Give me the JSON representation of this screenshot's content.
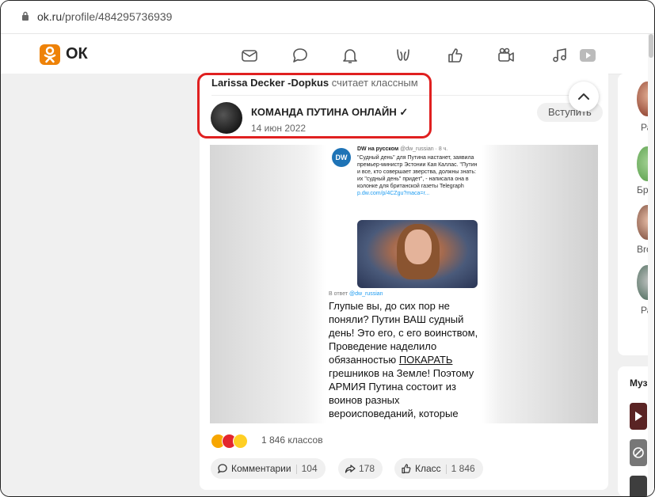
{
  "browser": {
    "url_domain": "ok.ru",
    "url_path": "/profile/484295736939"
  },
  "brand": {
    "logo_text": "ОК",
    "accent": "#ee8208"
  },
  "nav": {
    "icons": [
      "mail-icon",
      "chat-icon",
      "bell-icon",
      "guests-icon",
      "like-icon",
      "video-camera-icon",
      "music-icon",
      "video-play-icon"
    ]
  },
  "post": {
    "liked_by_name": "Larissa Decker -Dopkus",
    "liked_by_action": "считает классным",
    "group_name": "КОМАНДА ПУТИНА ОНЛАЙН ✓",
    "date": "14 июн 2022",
    "join_label": "Вступить",
    "image": {
      "dw_logo": "DW",
      "tweet_author": "DW на русском",
      "tweet_handle": "@dw_russian · 8 ч.",
      "tweet_text": "\"Судный день\" для Путина настанет, заявила премьер-министр Эстонии Кая Каллас. \"Путин и все, кто совершает зверства, должны знать: их \"судный день\" придет\", - написала она в колонке для британской газеты Telegraph",
      "tweet_link": "p.dw.com/p/4CZgu?maca=r...",
      "reply_label": "В ответ",
      "reply_handle": "@dw_russian",
      "reply_text_1": "Глупые вы, до сих пор не поняли? Путин ВАШ судный день! Это его, с его воинством, Проведение наделило обязанностью ",
      "reply_underlined": "ПОКАРАТЬ",
      "reply_text_2": " грешников на Земле! Поэтому АРМИЯ Путина состоит из воинов разных вероисповеданий, которые ЕДИНЫ В БОРЬБЕ со Злом!"
    },
    "reactions_count": "1 846 классов",
    "actions": {
      "comments_label": "Комментарии",
      "comments_count": "104",
      "shares_count": "178",
      "class_label": "Класс",
      "class_count": "1 846"
    }
  },
  "right_column": {
    "friends": [
      {
        "name": "Ра"
      },
      {
        "name": "Бро"
      },
      {
        "name": "Bro"
      },
      {
        "name": "Ра"
      }
    ],
    "music_title": "Музы"
  },
  "colors": {
    "highlight": "#e02020",
    "link": "#1d9bf0"
  }
}
